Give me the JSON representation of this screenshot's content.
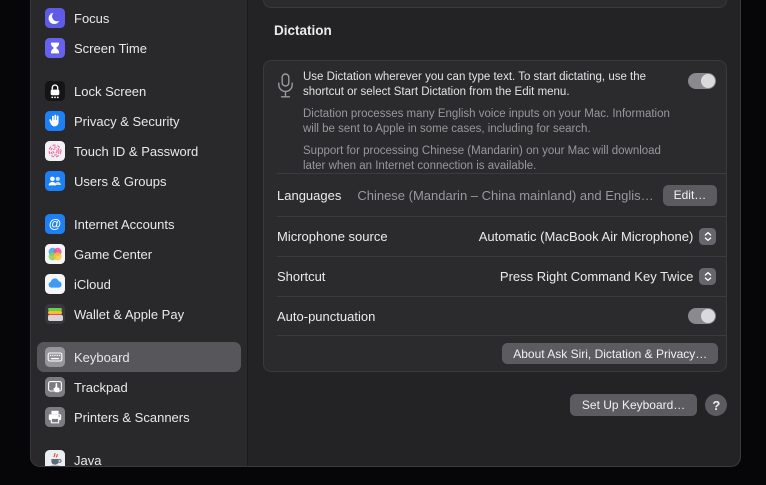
{
  "app": "System Settings",
  "colors": {
    "sidebar_bg": "#29292c",
    "content_bg": "#232325",
    "box_bg": "#2b2b2e",
    "selected_row": "#56565b",
    "toggle_track": "#89898e",
    "toggle_knob": "#dadadd",
    "button_bg": "#5b5b60",
    "accent_indigo": "#5e5ce6",
    "accent_blue": "#1d80f5",
    "touchid_pink": "#ef6a9e",
    "icloud_blue": "#3f9af5"
  },
  "sidebar": {
    "groups": [
      {
        "items": [
          {
            "label": "Focus",
            "icon": "focus-icon",
            "color": "#5e5ce6"
          },
          {
            "label": "Screen Time",
            "icon": "screen-time-icon",
            "color": "#6762ee"
          }
        ]
      },
      {
        "items": [
          {
            "label": "Lock Screen",
            "icon": "lock-icon",
            "color": "#141416"
          },
          {
            "label": "Privacy & Security",
            "icon": "hand-icon",
            "color": "#1d80f5"
          },
          {
            "label": "Touch ID & Password",
            "icon": "fingerprint-icon",
            "color": "#f2f2f6"
          },
          {
            "label": "Users & Groups",
            "icon": "users-icon",
            "color": "#1d80f5"
          }
        ]
      },
      {
        "items": [
          {
            "label": "Internet Accounts",
            "icon": "at-icon",
            "color": "#1d80f5"
          },
          {
            "label": "Game Center",
            "icon": "game-bubbles-icon",
            "color": "#f6f6f8"
          },
          {
            "label": "iCloud",
            "icon": "cloud-icon",
            "color": "#f6f6f8"
          },
          {
            "label": "Wallet & Apple Pay",
            "icon": "wallet-icon",
            "color": "#39393d"
          }
        ]
      },
      {
        "items": [
          {
            "label": "Keyboard",
            "icon": "keyboard-icon",
            "color": "#96969b",
            "selected": true
          },
          {
            "label": "Trackpad",
            "icon": "trackpad-icon",
            "color": "#7b7b81"
          },
          {
            "label": "Printers & Scanners",
            "icon": "printer-icon",
            "color": "#7b7b81"
          }
        ]
      },
      {
        "items": [
          {
            "label": "Java",
            "icon": "java-cup-icon",
            "color": "#eceff1"
          }
        ]
      }
    ]
  },
  "content": {
    "section_title": "Dictation",
    "dictation": {
      "enabled_toggle_state": "on",
      "intro": {
        "p1": "Use Dictation wherever you can type text. To start dictating, use the shortcut or select Start Dictation from the Edit menu.",
        "p2": "Dictation processes many English voice inputs on your Mac. Information will be sent to Apple in some cases, including for search.",
        "p3": "Support for processing Chinese (Mandarin) on your Mac will download later when an Internet connection is available."
      },
      "languages": {
        "label": "Languages",
        "value": "Chinese (Mandarin – China mainland) and Englis…",
        "edit_label": "Edit…"
      },
      "microphone": {
        "label": "Microphone source",
        "value": "Automatic (MacBook Air Microphone)"
      },
      "shortcut": {
        "label": "Shortcut",
        "value": "Press Right Command Key Twice"
      },
      "auto_punctuation": {
        "label": "Auto-punctuation",
        "state": "on"
      },
      "about_button": "About Ask Siri, Dictation & Privacy…"
    },
    "footer": {
      "setup_button": "Set Up Keyboard…",
      "help_button": "?"
    }
  }
}
